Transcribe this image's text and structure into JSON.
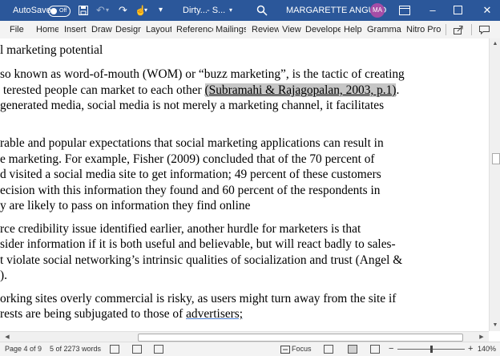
{
  "titlebar": {
    "autosave_label": "AutoSave",
    "autosave_state": "Off",
    "doc_title": "Dirty...",
    "doc_status": "- S...",
    "user_name": "MARGARETTE ANGULO",
    "user_initials": "MA",
    "accent_color": "#2b579a"
  },
  "ribbon": {
    "tabs": [
      "File",
      "Home",
      "Insert",
      "Draw",
      "Design",
      "Layout",
      "Reference",
      "Mailings",
      "Review",
      "View",
      "Developer",
      "Help",
      "Grammarly",
      "Nitro Pro"
    ]
  },
  "document": {
    "lines": [
      "l marketing potential",
      "so known as word-of-mouth (WOM) or “buzz marketing”, is the tactic of creating",
      " terested people can market to each other ",
      "generated media, social media is not merely a marketing channel, it facilitates",
      "rable and popular expectations that social marketing applications can result in",
      "e marketing. For example, Fisher (2009) concluded that of the 70 percent of",
      "d visited a social media site to get information; 49 percent of these customers",
      "ecision with this information they found and 60 percent of the respondents in",
      "y are likely to pass on information they find online",
      "rce credibility issue identified earlier, another hurdle for marketers is that",
      "sider information if it is both useful and believable, but will react badly to sales-",
      "t violate social networking’s intrinsic qualities of socialization and trust (Angel &",
      ").",
      "orking sites overly commercial is risky, as users might turn away from the site if",
      "rests are being subjugated to those of "
    ],
    "citation": "(Subramahi & Rajagopalan, 2003, p.1)",
    "citation_tail": ".",
    "last_word": "advertisers;"
  },
  "status": {
    "page": "Page 4 of 9",
    "words": "5 of 2273 words",
    "focus": "Focus",
    "zoom_minus": "−",
    "zoom_plus": "+",
    "zoom": "140%",
    "zoom_level_percent": 140
  },
  "icons": [
    "save-icon",
    "undo-icon",
    "redo-icon",
    "touch-mode-icon",
    "customize-icon",
    "search-icon",
    "minimize-icon",
    "maximize-icon",
    "close-icon",
    "share-icon",
    "comments-icon"
  ]
}
